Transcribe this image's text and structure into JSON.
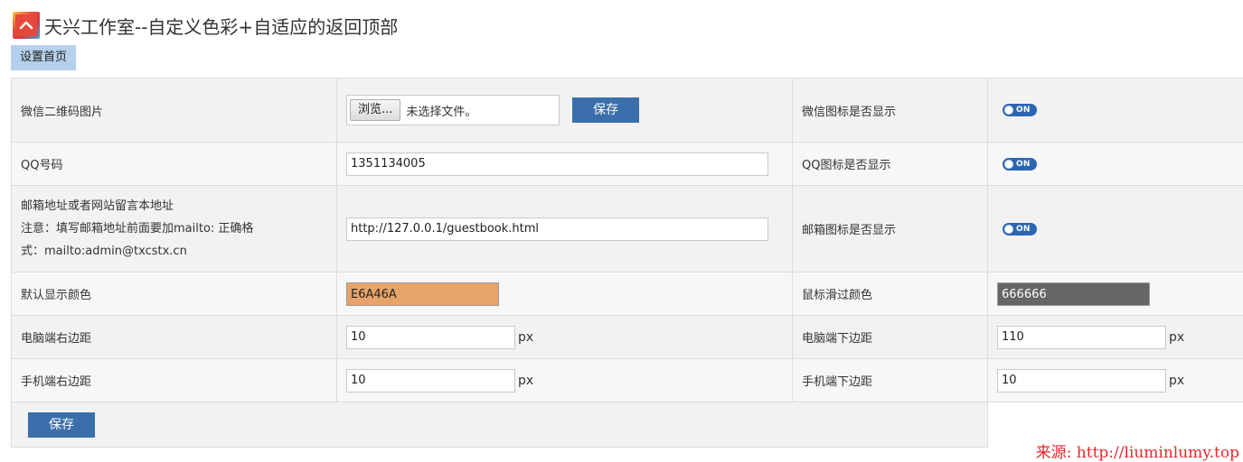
{
  "header": {
    "title": "天兴工作室--自定义色彩+自适应的返回顶部"
  },
  "tabs": [
    {
      "label": "设置首页"
    }
  ],
  "rows": {
    "wechat_qr": {
      "label": "微信二维码图片",
      "browse_label": "浏览...",
      "file_status": "未选择文件。",
      "save_label": "保存",
      "icon_label": "微信图标是否显示",
      "toggle_label": "ON"
    },
    "qq": {
      "label": "QQ号码",
      "value": "1351134005",
      "icon_label": "QQ图标是否显示",
      "toggle_label": "ON"
    },
    "mail": {
      "label_line1": "邮箱地址或者网站留言本地址",
      "label_line2": "注意：填写邮箱地址前面要加mailto: 正确格",
      "label_line3": "式：mailto:admin@txcstx.cn",
      "value": "http://127.0.0.1/guestbook.html",
      "icon_label": "邮箱图标是否显示",
      "toggle_label": "ON"
    },
    "colors": {
      "default_label": "默认显示颜色",
      "default_value": "E6A46A",
      "hover_label": "鼠标滑过颜色",
      "hover_value": "666666"
    },
    "pc_margin": {
      "right_label": "电脑端右边距",
      "right_value": "10",
      "right_unit": "px",
      "bottom_label": "电脑端下边距",
      "bottom_value": "110",
      "bottom_unit": "px"
    },
    "mobile_margin": {
      "right_label": "手机端右边距",
      "right_value": "10",
      "right_unit": "px",
      "bottom_label": "手机端下边距",
      "bottom_value": "10",
      "bottom_unit": "px"
    }
  },
  "footer": {
    "save_label": "保存"
  },
  "source": {
    "text": "来源: http://liuminlumy.top"
  },
  "colors": {
    "default_swatch": "#E6A46A",
    "hover_swatch": "#666666",
    "button_blue": "#3b6fab",
    "toggle_blue": "#2a66b4",
    "tab_bg": "#b5d0ea",
    "source_red": "#e8272b"
  }
}
